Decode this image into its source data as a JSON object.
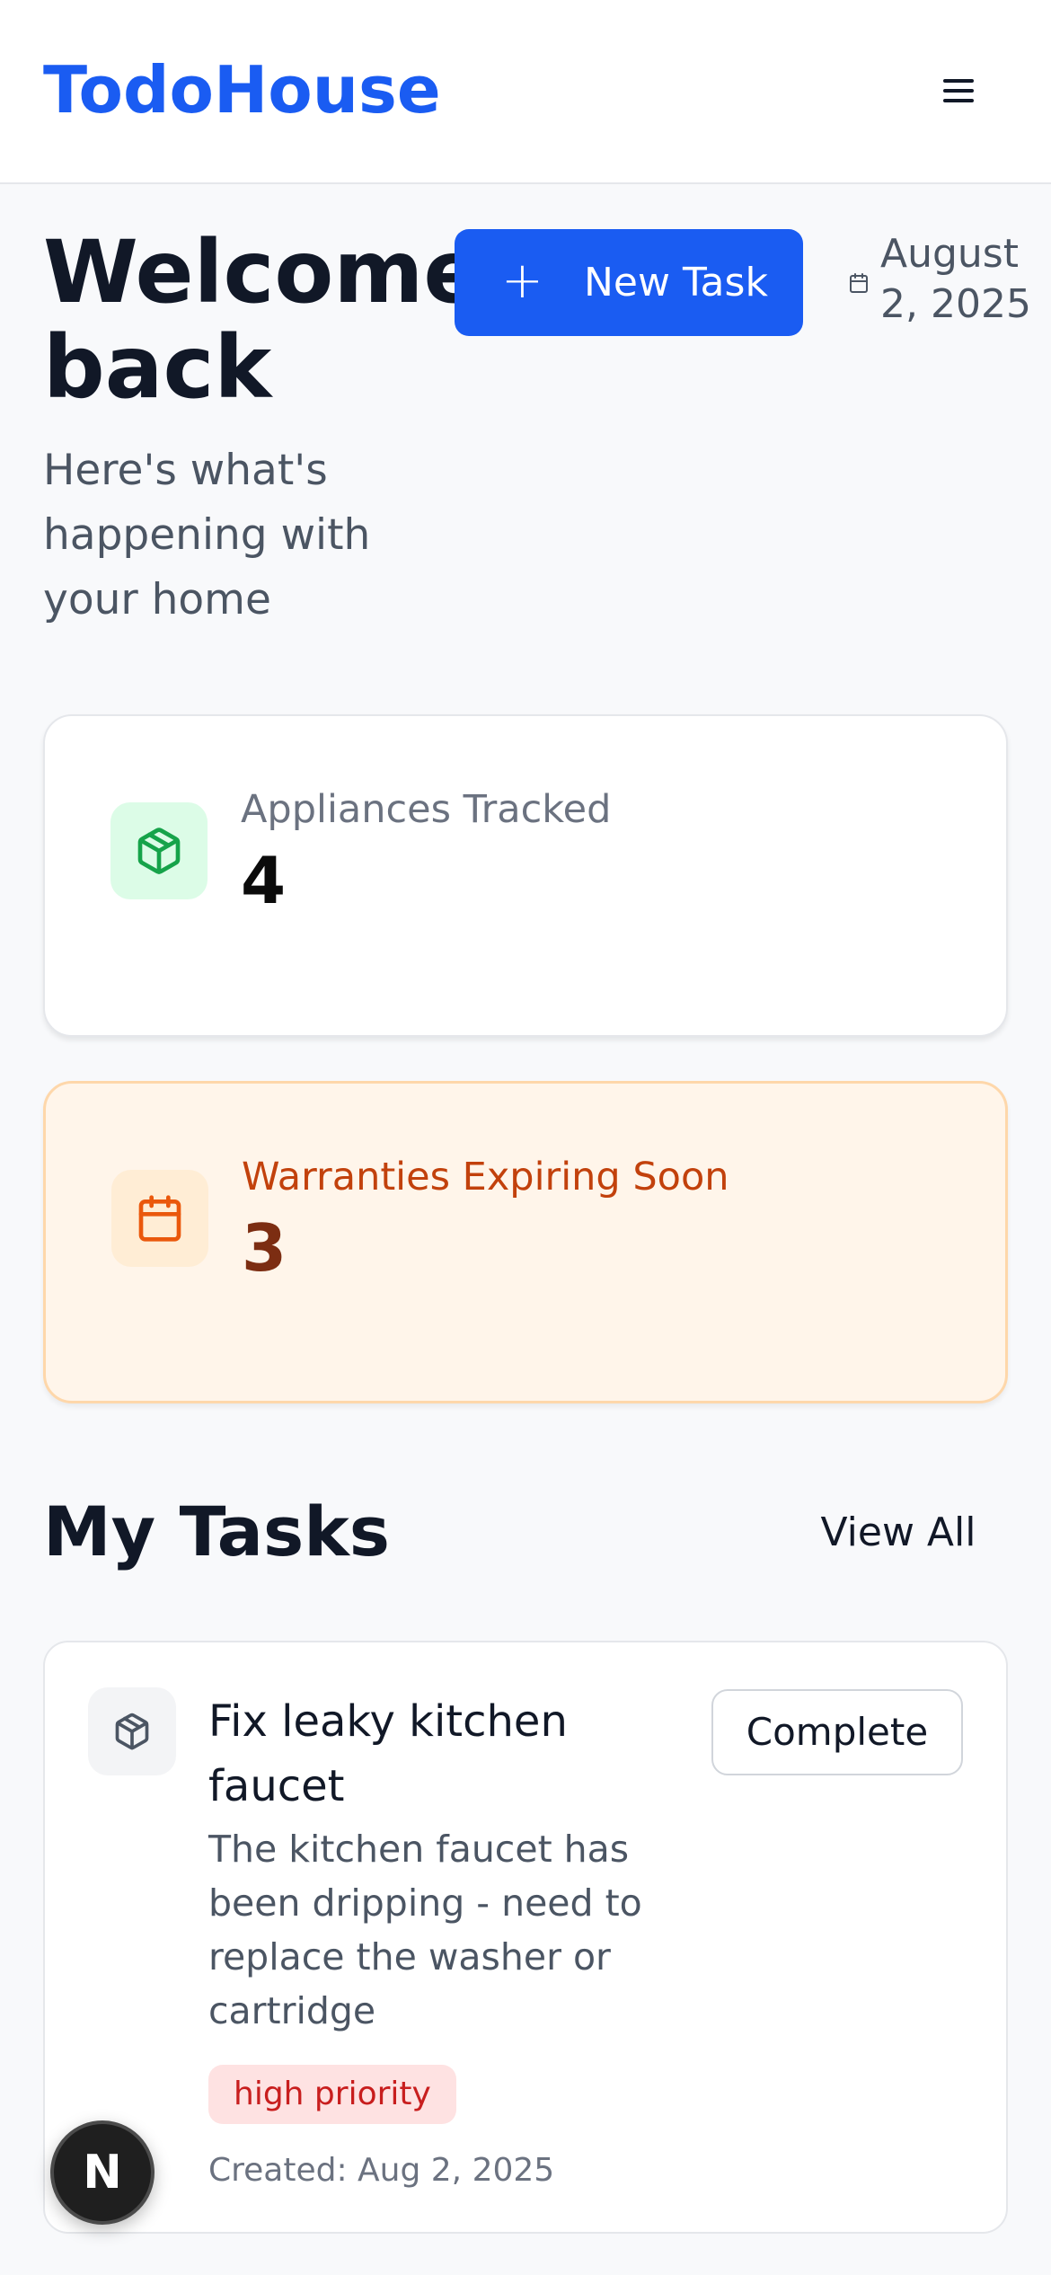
{
  "header": {
    "brand": "TodoHouse",
    "menu_icon": "hamburger-menu-icon"
  },
  "welcome": {
    "title": "Welcome back",
    "subtitle": "Here's what's happening with your home",
    "new_task_label": "New Task",
    "new_task_icon": "plus-icon",
    "date": "August 2, 2025",
    "date_icon": "calendar-icon"
  },
  "stats": {
    "appliances": {
      "label": "Appliances Tracked",
      "value": "4",
      "icon": "box-icon",
      "color": "#16a34a"
    },
    "warranties": {
      "label": "Warranties Expiring Soon",
      "value": "3",
      "icon": "calendar-icon",
      "color": "#ea580c"
    }
  },
  "tasks": {
    "title": "My Tasks",
    "view_all_label": "View All",
    "items": [
      {
        "title": "Fix leaky kitchen faucet",
        "description": "The kitchen faucet has been dripping - need to replace the washer or cartridge",
        "complete_label": "Complete",
        "priority": "high priority",
        "created": "Created: Aug 2, 2025",
        "icon": "box-icon"
      }
    ]
  },
  "dev_badge": {
    "letter": "N"
  },
  "colors": {
    "brand": "#1a5cf2",
    "background": "#f8f9fb",
    "priority_high": "#c81e1e"
  }
}
